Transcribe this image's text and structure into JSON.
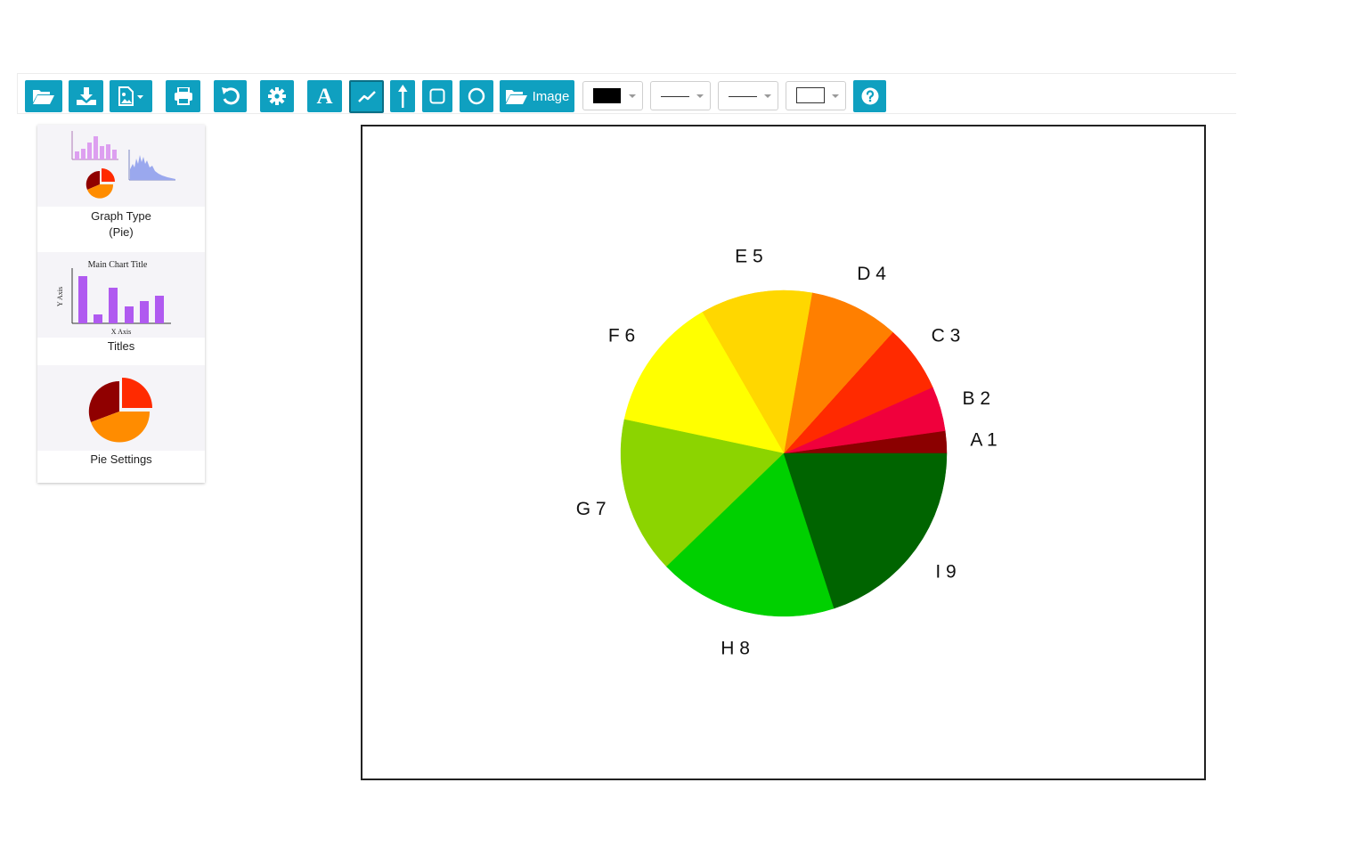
{
  "toolbar": {
    "open_icon": "folder-open-icon",
    "download_icon": "download-icon",
    "export_image_icon": "image-export-icon",
    "print_icon": "print-icon",
    "undo_icon": "undo-icon",
    "settings_icon": "gear-icon",
    "text_tool_label": "A",
    "line_tool_icon": "line-chart-icon",
    "arrow_tool_icon": "arrow-up-icon",
    "rectangle_tool_icon": "square-icon",
    "circle_tool_icon": "circle-icon",
    "image_button_label": "Image",
    "color_value": "#000000",
    "help_icon": "question-circle-icon"
  },
  "side_panel": {
    "items": [
      {
        "label_line1": "Graph Type",
        "label_line2": "(Pie)"
      },
      {
        "label": "Titles",
        "thumb_title": "Main Chart Title",
        "thumb_xaxis": "X Axis",
        "thumb_yaxis": "Y Axis"
      },
      {
        "label": "Pie Settings"
      }
    ]
  },
  "chart_data": {
    "type": "pie",
    "title": "",
    "start_angle_deg": 0,
    "direction": "counterclockwise",
    "slices": [
      {
        "label": "A 1",
        "value": 1,
        "color": "#8b0000"
      },
      {
        "label": "B 2",
        "value": 2,
        "color": "#f0003c"
      },
      {
        "label": "C 3",
        "value": 3,
        "color": "#ff2a00"
      },
      {
        "label": "D 4",
        "value": 4,
        "color": "#ff7f00"
      },
      {
        "label": "E 5",
        "value": 5,
        "color": "#ffd700"
      },
      {
        "label": "F 6",
        "value": 6,
        "color": "#ffff00"
      },
      {
        "label": "G 7",
        "value": 7,
        "color": "#8cd400"
      },
      {
        "label": "H 8",
        "value": 8,
        "color": "#00d000"
      },
      {
        "label": "I 9",
        "value": 9,
        "color": "#006400"
      }
    ]
  }
}
